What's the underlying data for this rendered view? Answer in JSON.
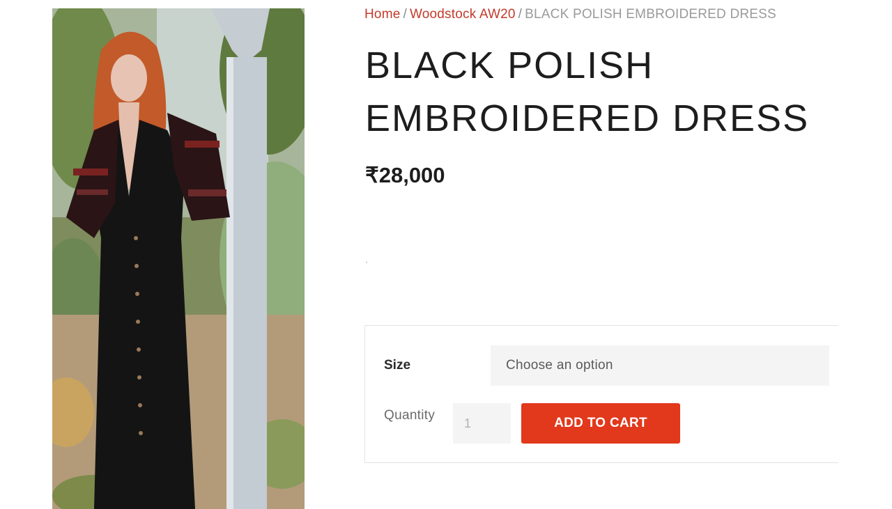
{
  "breadcrumb": {
    "home": "Home",
    "separator": "/",
    "collection": "Woodstock AW20",
    "current": "BLACK POLISH EMBROIDERED DRESS"
  },
  "product": {
    "title_line1": "BLACK POLISH",
    "title_line2": "EMBROIDERED DRESS",
    "price": "₹28,000",
    "image_icon": "product-photo-model-black-dress"
  },
  "form": {
    "size_label": "Size",
    "size_select_value": "Choose an option",
    "quantity_label": "Quantity",
    "quantity_value": "1",
    "add_to_cart_label": "ADD TO CART"
  },
  "colors": {
    "accent": "#e2381b",
    "link": "#c23a2a",
    "text": "#1d1d1d"
  }
}
